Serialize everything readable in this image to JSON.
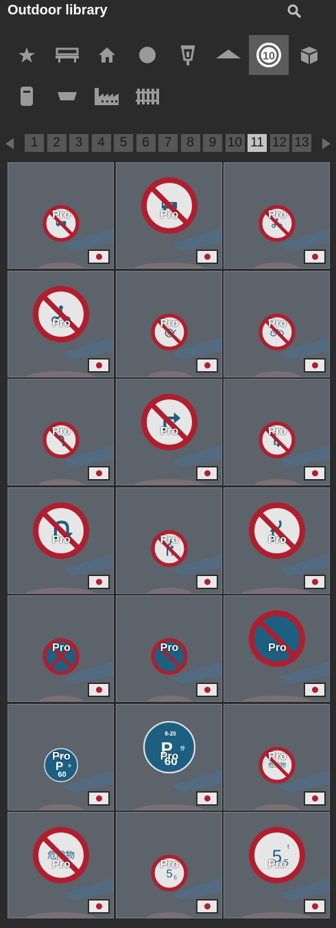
{
  "header": {
    "title": "Outdoor library"
  },
  "categories": [
    {
      "name": "star-icon",
      "active": false
    },
    {
      "name": "bench-icon",
      "active": false
    },
    {
      "name": "house-icon",
      "active": false
    },
    {
      "name": "circle-icon",
      "active": false
    },
    {
      "name": "lantern-icon",
      "active": false
    },
    {
      "name": "roof-icon",
      "active": false
    },
    {
      "name": "speed-sign-icon",
      "label": "10",
      "active": true
    },
    {
      "name": "box-icon",
      "active": false
    },
    {
      "name": "bin-icon",
      "active": false
    },
    {
      "name": "planter-icon",
      "active": false
    },
    {
      "name": "factory-icon",
      "active": false
    },
    {
      "name": "fence-icon",
      "active": false
    }
  ],
  "pagination": {
    "pages": [
      "1",
      "2",
      "3",
      "4",
      "5",
      "6",
      "7",
      "8",
      "9",
      "10",
      "11",
      "12",
      "13"
    ],
    "current": "11"
  },
  "tiles": [
    {
      "sign": "no-bus",
      "badge": "Pro"
    },
    {
      "sign": "no-bus",
      "badge": "Pro"
    },
    {
      "sign": "no-motorcycle",
      "badge": "Pro"
    },
    {
      "sign": "no-moped",
      "badge": "Pro"
    },
    {
      "sign": "no-cart",
      "badge": "Pro"
    },
    {
      "sign": "no-bicycle",
      "badge": "Pro"
    },
    {
      "sign": "no-left-turn",
      "badge": "Pro"
    },
    {
      "sign": "no-right-turn",
      "badge": "Pro"
    },
    {
      "sign": "no-turn",
      "badge": "Pro"
    },
    {
      "sign": "no-u-turn",
      "badge": "Pro"
    },
    {
      "sign": "no-overtaking",
      "badge": "Pro"
    },
    {
      "sign": "no-lane-change",
      "badge": "Pro"
    },
    {
      "sign": "no-stopping",
      "badge": "Pro"
    },
    {
      "sign": "no-parking",
      "badge": "Pro"
    },
    {
      "sign": "no-parking",
      "badge": "Pro"
    },
    {
      "sign": "parking-time",
      "badge": "Pro",
      "text": "8-20",
      "num": "60",
      "unit": "分"
    },
    {
      "sign": "parking-time",
      "badge": "Pro",
      "text": "8-20",
      "num": "60",
      "unit": "分"
    },
    {
      "sign": "no-hazmat",
      "badge": "Pro",
      "text": "危険物"
    },
    {
      "sign": "no-hazmat",
      "badge": "Pro",
      "text": "危険物"
    },
    {
      "sign": "weight-limit",
      "badge": "Pro",
      "text": "5.5"
    },
    {
      "sign": "weight-limit",
      "badge": "Pro",
      "text": "5.5",
      "unit": "t"
    }
  ],
  "colors": {
    "accent_red": "#b01e2e",
    "sign_blue": "#1d5f80",
    "tile_bg": "#5c636b",
    "active_page": "#c4c4c4"
  }
}
